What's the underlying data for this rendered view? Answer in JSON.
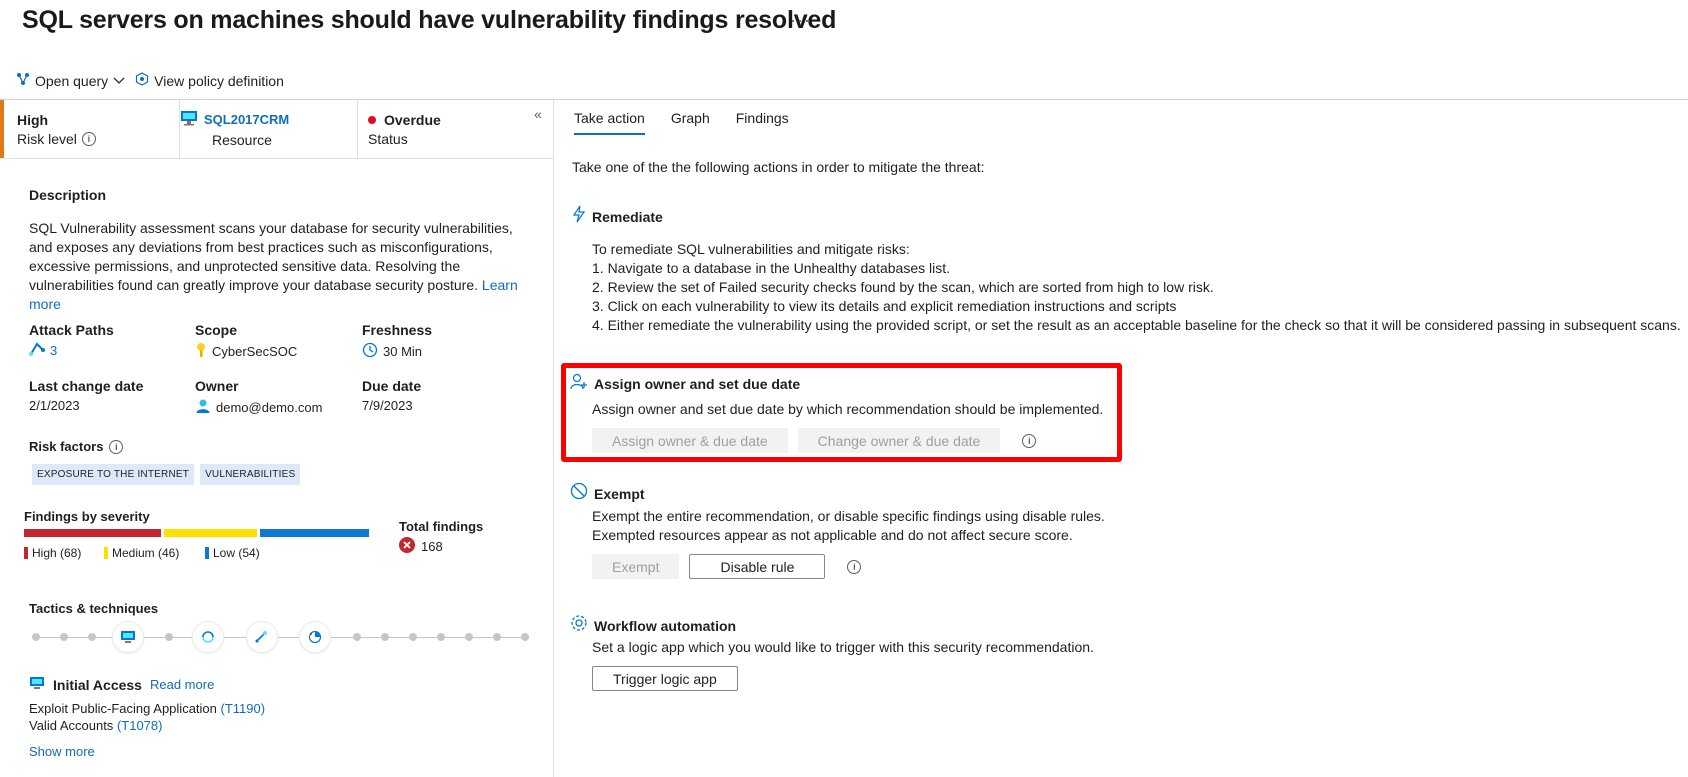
{
  "title": "SQL servers on machines should have vulnerability findings resolved",
  "more_label": "···",
  "toolbar": {
    "open_query": "Open query",
    "view_policy": "View policy definition"
  },
  "status": {
    "risk_value": "High",
    "risk_label": "Risk level",
    "resource_value": "SQL2017CRM",
    "resource_label": "Resource",
    "status_value": "Overdue",
    "status_label": "Status"
  },
  "description": {
    "heading": "Description",
    "text": "SQL Vulnerability assessment scans your database for security vulnerabilities, and exposes any deviations from best practices such as misconfigurations, excessive permissions, and unprotected sensitive data. Resolving the vulnerabilities found can greatly improve your database security posture.",
    "learn_more": "Learn more"
  },
  "meta": {
    "attack_paths_label": "Attack Paths",
    "attack_paths_value": "3",
    "scope_label": "Scope",
    "scope_value": "CyberSecSOC",
    "freshness_label": "Freshness",
    "freshness_value": "30 Min",
    "last_change_label": "Last change date",
    "last_change_value": "2/1/2023",
    "owner_label": "Owner",
    "owner_value": "demo@demo.com",
    "due_label": "Due date",
    "due_value": "7/9/2023"
  },
  "risk_factors": {
    "heading": "Risk factors",
    "tags": [
      "EXPOSURE TO THE INTERNET",
      "VULNERABILITIES"
    ]
  },
  "findings": {
    "heading": "Findings by severity",
    "high": "High (68)",
    "medium": "Medium (46)",
    "low": "Low (54)",
    "total_label": "Total findings",
    "total_value": "168",
    "colors": {
      "high": "#c4262e",
      "medium": "#fce100",
      "low": "#0f78d4"
    }
  },
  "tactics": {
    "heading": "Tactics & techniques",
    "initial_access": "Initial Access",
    "read_more": "Read more",
    "t1_text": "Exploit Public-Facing Application",
    "t1_code": "(T1190)",
    "t2_text": "Valid Accounts",
    "t2_code": "(T1078)",
    "show_more": "Show more"
  },
  "tabs": [
    "Take action",
    "Graph",
    "Findings"
  ],
  "right": {
    "intro": "Take one of the the following actions in order to mitigate the threat:",
    "remediate": {
      "heading": "Remediate",
      "line0": "To remediate SQL vulnerabilities and mitigate risks:",
      "line1": "1. Navigate to a database in the Unhealthy databases list.",
      "line2": "2. Review the set of Failed security checks found by the scan, which are sorted from high to low risk.",
      "line3": "3. Click on each vulnerability to view its details and explicit remediation instructions and scripts",
      "line4": "4. Either remediate the vulnerability using the provided script, or set the result as an acceptable baseline for the check so that it will be considered passing in subsequent scans."
    },
    "assign": {
      "heading": "Assign owner and set due date",
      "text": "Assign owner and set due date by which recommendation should be implemented.",
      "btn1": "Assign owner & due date",
      "btn2": "Change owner & due date"
    },
    "exempt": {
      "heading": "Exempt",
      "line1": "Exempt the entire recommendation, or disable specific findings using disable rules.",
      "line2": "Exempted resources appear as not applicable and do not affect secure score.",
      "btn1": "Exempt",
      "btn2": "Disable rule"
    },
    "workflow": {
      "heading": "Workflow automation",
      "text": "Set a logic app which you would like to trigger with this security recommendation.",
      "btn": "Trigger logic app"
    }
  }
}
